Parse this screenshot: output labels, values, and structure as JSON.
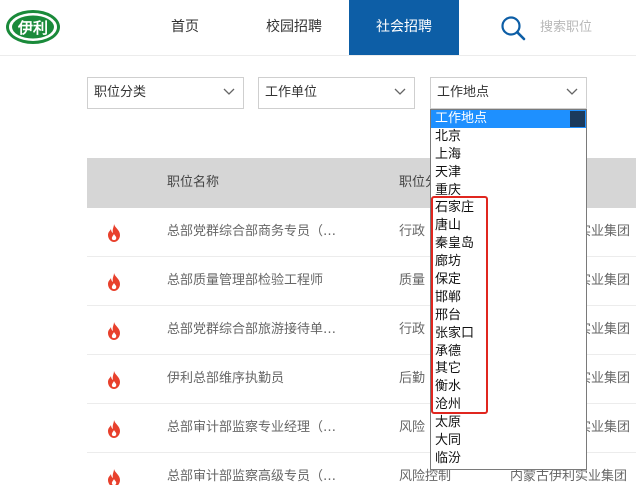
{
  "brand": {
    "logo_text": "伊利",
    "accent": "#0d5ea6",
    "logo_color": "#1a8a3a"
  },
  "nav": {
    "home": "首页",
    "campus": "校园招聘",
    "social": "社会招聘",
    "search_placeholder": "搜索职位"
  },
  "filters": {
    "category": "职位分类",
    "unit": "工作单位",
    "location": "工作地点"
  },
  "table": {
    "header_name": "职位名称",
    "header_type": "职位分",
    "rows": [
      {
        "title": "总部党群综合部商务专员（…",
        "type": "行政",
        "company": "实业集团"
      },
      {
        "title": "总部质量管理部检验工程师",
        "type": "质量",
        "company": "实业集团"
      },
      {
        "title": "总部党群综合部旅游接待单…",
        "type": "行政",
        "company": "实业集团"
      },
      {
        "title": "伊利总部维序执勤员",
        "type": "后勤",
        "company": "实业集团"
      },
      {
        "title": "总部审计部监察专业经理（…",
        "type": "风险",
        "company": "实业集团"
      },
      {
        "title": "总部审计部监察高级专员（…",
        "type": "风险控制",
        "company": "内蒙古伊利实业集团"
      }
    ]
  },
  "location_options": [
    "工作地点",
    "北京",
    "上海",
    "天津",
    "重庆",
    "石家庄",
    "唐山",
    "秦皇岛",
    "廊坊",
    "保定",
    "邯郸",
    "邢台",
    "张家口",
    "承德",
    "其它",
    "衡水",
    "沧州",
    "太原",
    "大同",
    "临汾"
  ],
  "selected_location": "工作地点"
}
